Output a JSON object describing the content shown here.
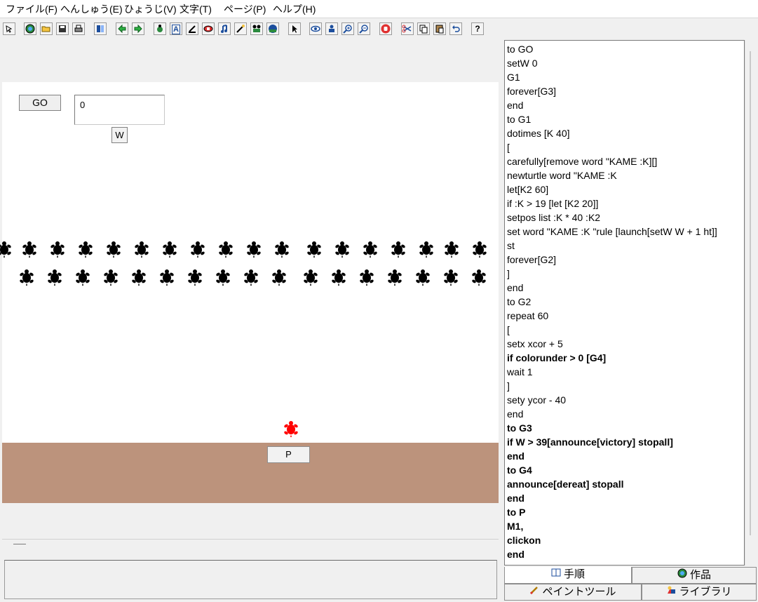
{
  "menu": [
    "ファイル(F)",
    "へんしゅう(E)",
    "ひょうじ(V)",
    "文字(T)",
    "ページ(P)",
    "ヘルプ(H)"
  ],
  "toolbar": {
    "icons": [
      "pointer-small-icon",
      "globe-icon",
      "open-folder-icon",
      "save-disk-icon",
      "print-icon",
      "page-list-icon",
      "arrow-left-icon",
      "arrow-right-icon",
      "turtle-hatch-icon",
      "text-box-icon",
      "paint-pen-icon",
      "shape-icon",
      "music-note-icon",
      "magic-wand-icon",
      "movie-icon",
      "record-icon",
      "pointer-icon",
      "eye-icon",
      "stamp-icon",
      "zoom-in-icon",
      "zoom-out-icon",
      "stop-hand-icon",
      "scissors-icon",
      "copy-icon",
      "paste-icon",
      "undo-icon",
      "help-icon"
    ],
    "help_label": "?",
    "text_label": "A"
  },
  "canvas": {
    "go_label": "GO",
    "number_value": "0",
    "w_label": "W",
    "p_label": "P",
    "turtle_color": "#000000",
    "player_turtle_color": "#ff0000",
    "ground_color": "#bc937c"
  },
  "procedures": [
    {
      "text": "to GO",
      "bold": false
    },
    {
      "text": "setW 0",
      "bold": false
    },
    {
      "text": "G1",
      "bold": false
    },
    {
      "text": "forever[G3]",
      "bold": false
    },
    {
      "text": "end",
      "bold": false
    },
    {
      "text": "to G1",
      "bold": false
    },
    {
      "text": "dotimes [K 40]",
      "bold": false
    },
    {
      "text": "[",
      "bold": false
    },
    {
      "text": "carefully[remove word \"KAME :K][]",
      "bold": false
    },
    {
      "text": "newturtle word \"KAME :K",
      "bold": false
    },
    {
      "text": "let[K2 60]",
      "bold": false
    },
    {
      "text": "if :K > 19 [let [K2 20]]",
      "bold": false
    },
    {
      "text": "setpos list :K * 40 :K2",
      "bold": false
    },
    {
      "text": "set word \"KAME :K \"rule [launch[setW W + 1 ht]]",
      "bold": false
    },
    {
      "text": "st",
      "bold": false
    },
    {
      "text": "forever[G2]",
      "bold": false
    },
    {
      "text": "]",
      "bold": false
    },
    {
      "text": "end",
      "bold": false
    },
    {
      "text": "to G2",
      "bold": false
    },
    {
      "text": "repeat 60",
      "bold": false
    },
    {
      "text": "[",
      "bold": false
    },
    {
      "text": "setx xcor + 5",
      "bold": false
    },
    {
      "text": "if colorunder > 0 [G4]",
      "bold": true
    },
    {
      "text": "wait 1",
      "bold": false
    },
    {
      "text": "]",
      "bold": false
    },
    {
      "text": "sety ycor - 40",
      "bold": false
    },
    {
      "text": "end",
      "bold": false
    },
    {
      "text": "to G3",
      "bold": true
    },
    {
      "text": "if W > 39[announce[victory] stopall]",
      "bold": true
    },
    {
      "text": "end",
      "bold": true
    },
    {
      "text": "to G4",
      "bold": true
    },
    {
      "text": "announce[dereat] stopall",
      "bold": true
    },
    {
      "text": "end",
      "bold": true
    },
    {
      "text": "to P",
      "bold": true
    },
    {
      "text": "M1,",
      "bold": true
    },
    {
      "text": "clickon",
      "bold": true
    },
    {
      "text": "end",
      "bold": true
    }
  ],
  "tabs": [
    {
      "label": "手順",
      "icon": "book-icon",
      "active": true
    },
    {
      "label": "作品",
      "icon": "globe-icon",
      "active": false
    },
    {
      "label": "ペイントツール",
      "icon": "paintbrush-icon",
      "active": false
    },
    {
      "label": "ライブラリ",
      "icon": "shapes-icon",
      "active": false
    }
  ]
}
